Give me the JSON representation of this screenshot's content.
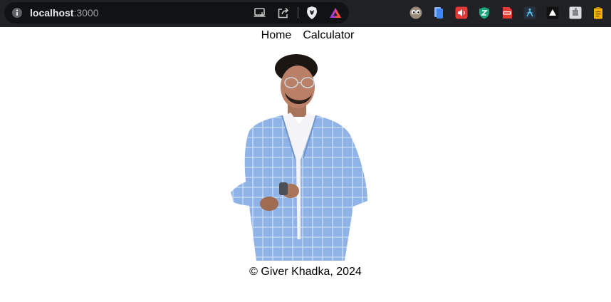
{
  "browser": {
    "url_host": "localhost",
    "url_port": ":3000"
  },
  "nav": {
    "items": [
      {
        "label": "Home"
      },
      {
        "label": "Calculator"
      }
    ]
  },
  "footer": {
    "text": "© Giver Khadka, 2024"
  }
}
